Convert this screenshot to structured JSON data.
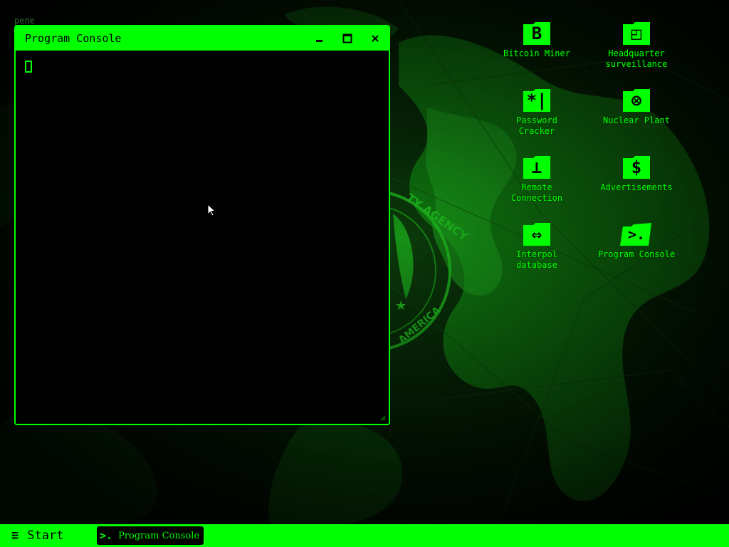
{
  "corner_text": "pene",
  "window": {
    "title": "Program Console",
    "minimize_glyph": "‒",
    "maximize_glyph": "☐",
    "close_glyph": "×"
  },
  "desktop_icons": [
    {
      "label": "Bitcoin Miner",
      "glyph": "B",
      "icon": "bitcoin-icon"
    },
    {
      "label": "Headquarter\nsurveillance",
      "glyph": "◰",
      "icon": "surveillance-icon"
    },
    {
      "label": "Password\nCracker",
      "glyph": "*|",
      "icon": "password-icon"
    },
    {
      "label": "Nuclear Plant",
      "glyph": "⊗",
      "icon": "nuclear-icon"
    },
    {
      "label": "Remote\nConnection",
      "glyph": "⊥",
      "icon": "remote-icon"
    },
    {
      "label": "Advertisements",
      "glyph": "$",
      "icon": "dollar-icon"
    },
    {
      "label": "Interpol\ndatabase",
      "glyph": "⇔",
      "icon": "exchange-icon"
    },
    {
      "label": "Program Console",
      "glyph": ">.",
      "icon": "terminal-icon"
    }
  ],
  "taskbar": {
    "start_glyph": "≡",
    "start_label": "Start",
    "task_glyph": ">.",
    "task_label": "Program Console"
  },
  "colors": {
    "accent": "#00ff00",
    "background": "#000000"
  }
}
